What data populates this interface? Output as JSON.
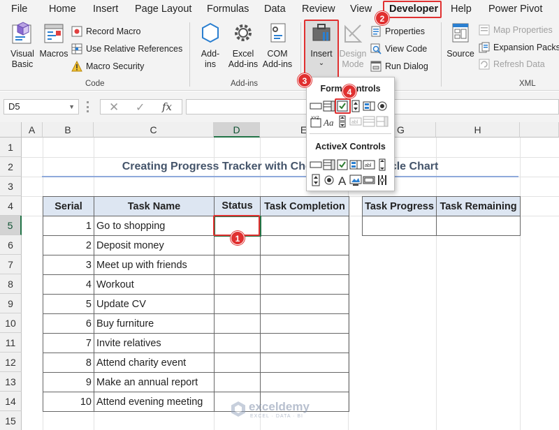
{
  "tabs": [
    "File",
    "Home",
    "Insert",
    "Page Layout",
    "Formulas",
    "Data",
    "Review",
    "View",
    "Developer",
    "Help",
    "Power Pivot"
  ],
  "active_tab": "Developer",
  "ribbon": {
    "code": {
      "visual_basic": "Visual Basic",
      "macros": "Macros",
      "record_macro": "Record Macro",
      "use_relative": "Use Relative References",
      "macro_security": "Macro Security",
      "label": "Code"
    },
    "addins": {
      "addins": "Add-ins",
      "excel_addins": "Excel Add-ins",
      "com_addins": "COM Add-ins",
      "label": "Add-ins"
    },
    "controls": {
      "insert": "Insert",
      "design_mode": "Design Mode",
      "properties": "Properties",
      "view_code": "View Code",
      "run_dialog": "Run Dialog"
    },
    "xml": {
      "source": "Source",
      "map_properties": "Map Properties",
      "expansion_packs": "Expansion Packs",
      "refresh_data": "Refresh Data",
      "label": "XML"
    }
  },
  "formula_bar": {
    "name_box": "D5",
    "fx": "fx",
    "value": ""
  },
  "dropdown": {
    "form_controls": "Form Controls",
    "activex_controls": "ActiveX Controls"
  },
  "columns": [
    "A",
    "B",
    "C",
    "D",
    "E",
    "G",
    "H"
  ],
  "selected_column": "D",
  "rows": [
    "1",
    "2",
    "3",
    "4",
    "5",
    "6",
    "7",
    "8",
    "9",
    "10",
    "11",
    "12",
    "13",
    "14",
    "15"
  ],
  "selected_row": "5",
  "sheet": {
    "title": "Creating Progress Tracker with Check Boxes & Circle Chart",
    "headers": [
      "Serial",
      "Task Name",
      "Status",
      "Task Completion"
    ],
    "tasks": [
      {
        "serial": "1",
        "name": "Go to shopping"
      },
      {
        "serial": "2",
        "name": "Deposit money"
      },
      {
        "serial": "3",
        "name": "Meet up with friends"
      },
      {
        "serial": "4",
        "name": "Workout"
      },
      {
        "serial": "5",
        "name": "Update CV"
      },
      {
        "serial": "6",
        "name": "Buy furniture"
      },
      {
        "serial": "7",
        "name": "Invite relatives"
      },
      {
        "serial": "8",
        "name": "Attend charity event"
      },
      {
        "serial": "9",
        "name": "Make an annual report"
      },
      {
        "serial": "10",
        "name": "Attend evening meeting"
      }
    ],
    "progress_headers": [
      "Task Progress",
      "Task Remaining"
    ]
  },
  "badges": [
    "1",
    "2",
    "3",
    "4"
  ],
  "watermark": {
    "name": "exceldemy",
    "tagline": "EXCEL · DATA · BI"
  },
  "colors": {
    "accent_red": "#e03030",
    "excel_green": "#217346",
    "header_fill": "#dde6f2",
    "title_color": "#44546a"
  }
}
